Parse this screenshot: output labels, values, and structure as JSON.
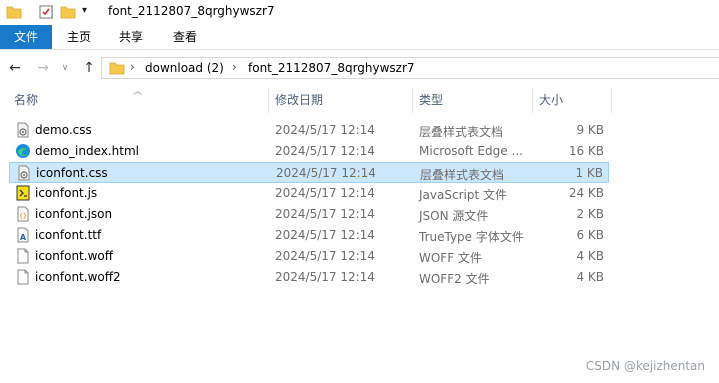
{
  "window": {
    "title": "font_2112807_8qrghywszr7"
  },
  "ribbon": {
    "tabs": [
      "文件",
      "主页",
      "共享",
      "查看"
    ]
  },
  "nav": {
    "breadcrumbs": [
      "download (2)",
      "font_2112807_8qrghywszr7"
    ]
  },
  "columns": {
    "name": "名称",
    "date": "修改日期",
    "type": "类型",
    "size": "大小"
  },
  "files": [
    {
      "name": "demo.css",
      "date": "2024/5/17 12:14",
      "type": "层叠样式表文档",
      "size": "9 KB",
      "icon": "css-file-icon"
    },
    {
      "name": "demo_index.html",
      "date": "2024/5/17 12:14",
      "type": "Microsoft Edge ...",
      "size": "16 KB",
      "icon": "edge-html-icon"
    },
    {
      "name": "iconfont.css",
      "date": "2024/5/17 12:14",
      "type": "层叠样式表文档",
      "size": "1 KB",
      "icon": "css-file-icon",
      "selected": true
    },
    {
      "name": "iconfont.js",
      "date": "2024/5/17 12:14",
      "type": "JavaScript 文件",
      "size": "24 KB",
      "icon": "js-file-icon"
    },
    {
      "name": "iconfont.json",
      "date": "2024/5/17 12:14",
      "type": "JSON 源文件",
      "size": "2 KB",
      "icon": "json-file-icon"
    },
    {
      "name": "iconfont.ttf",
      "date": "2024/5/17 12:14",
      "type": "TrueType 字体文件",
      "size": "6 KB",
      "icon": "font-file-icon"
    },
    {
      "name": "iconfont.woff",
      "date": "2024/5/17 12:14",
      "type": "WOFF 文件",
      "size": "4 KB",
      "icon": "blank-file-icon"
    },
    {
      "name": "iconfont.woff2",
      "date": "2024/5/17 12:14",
      "type": "WOFF2 文件",
      "size": "4 KB",
      "icon": "blank-file-icon"
    }
  ],
  "watermark": "CSDN @kejizhentan"
}
